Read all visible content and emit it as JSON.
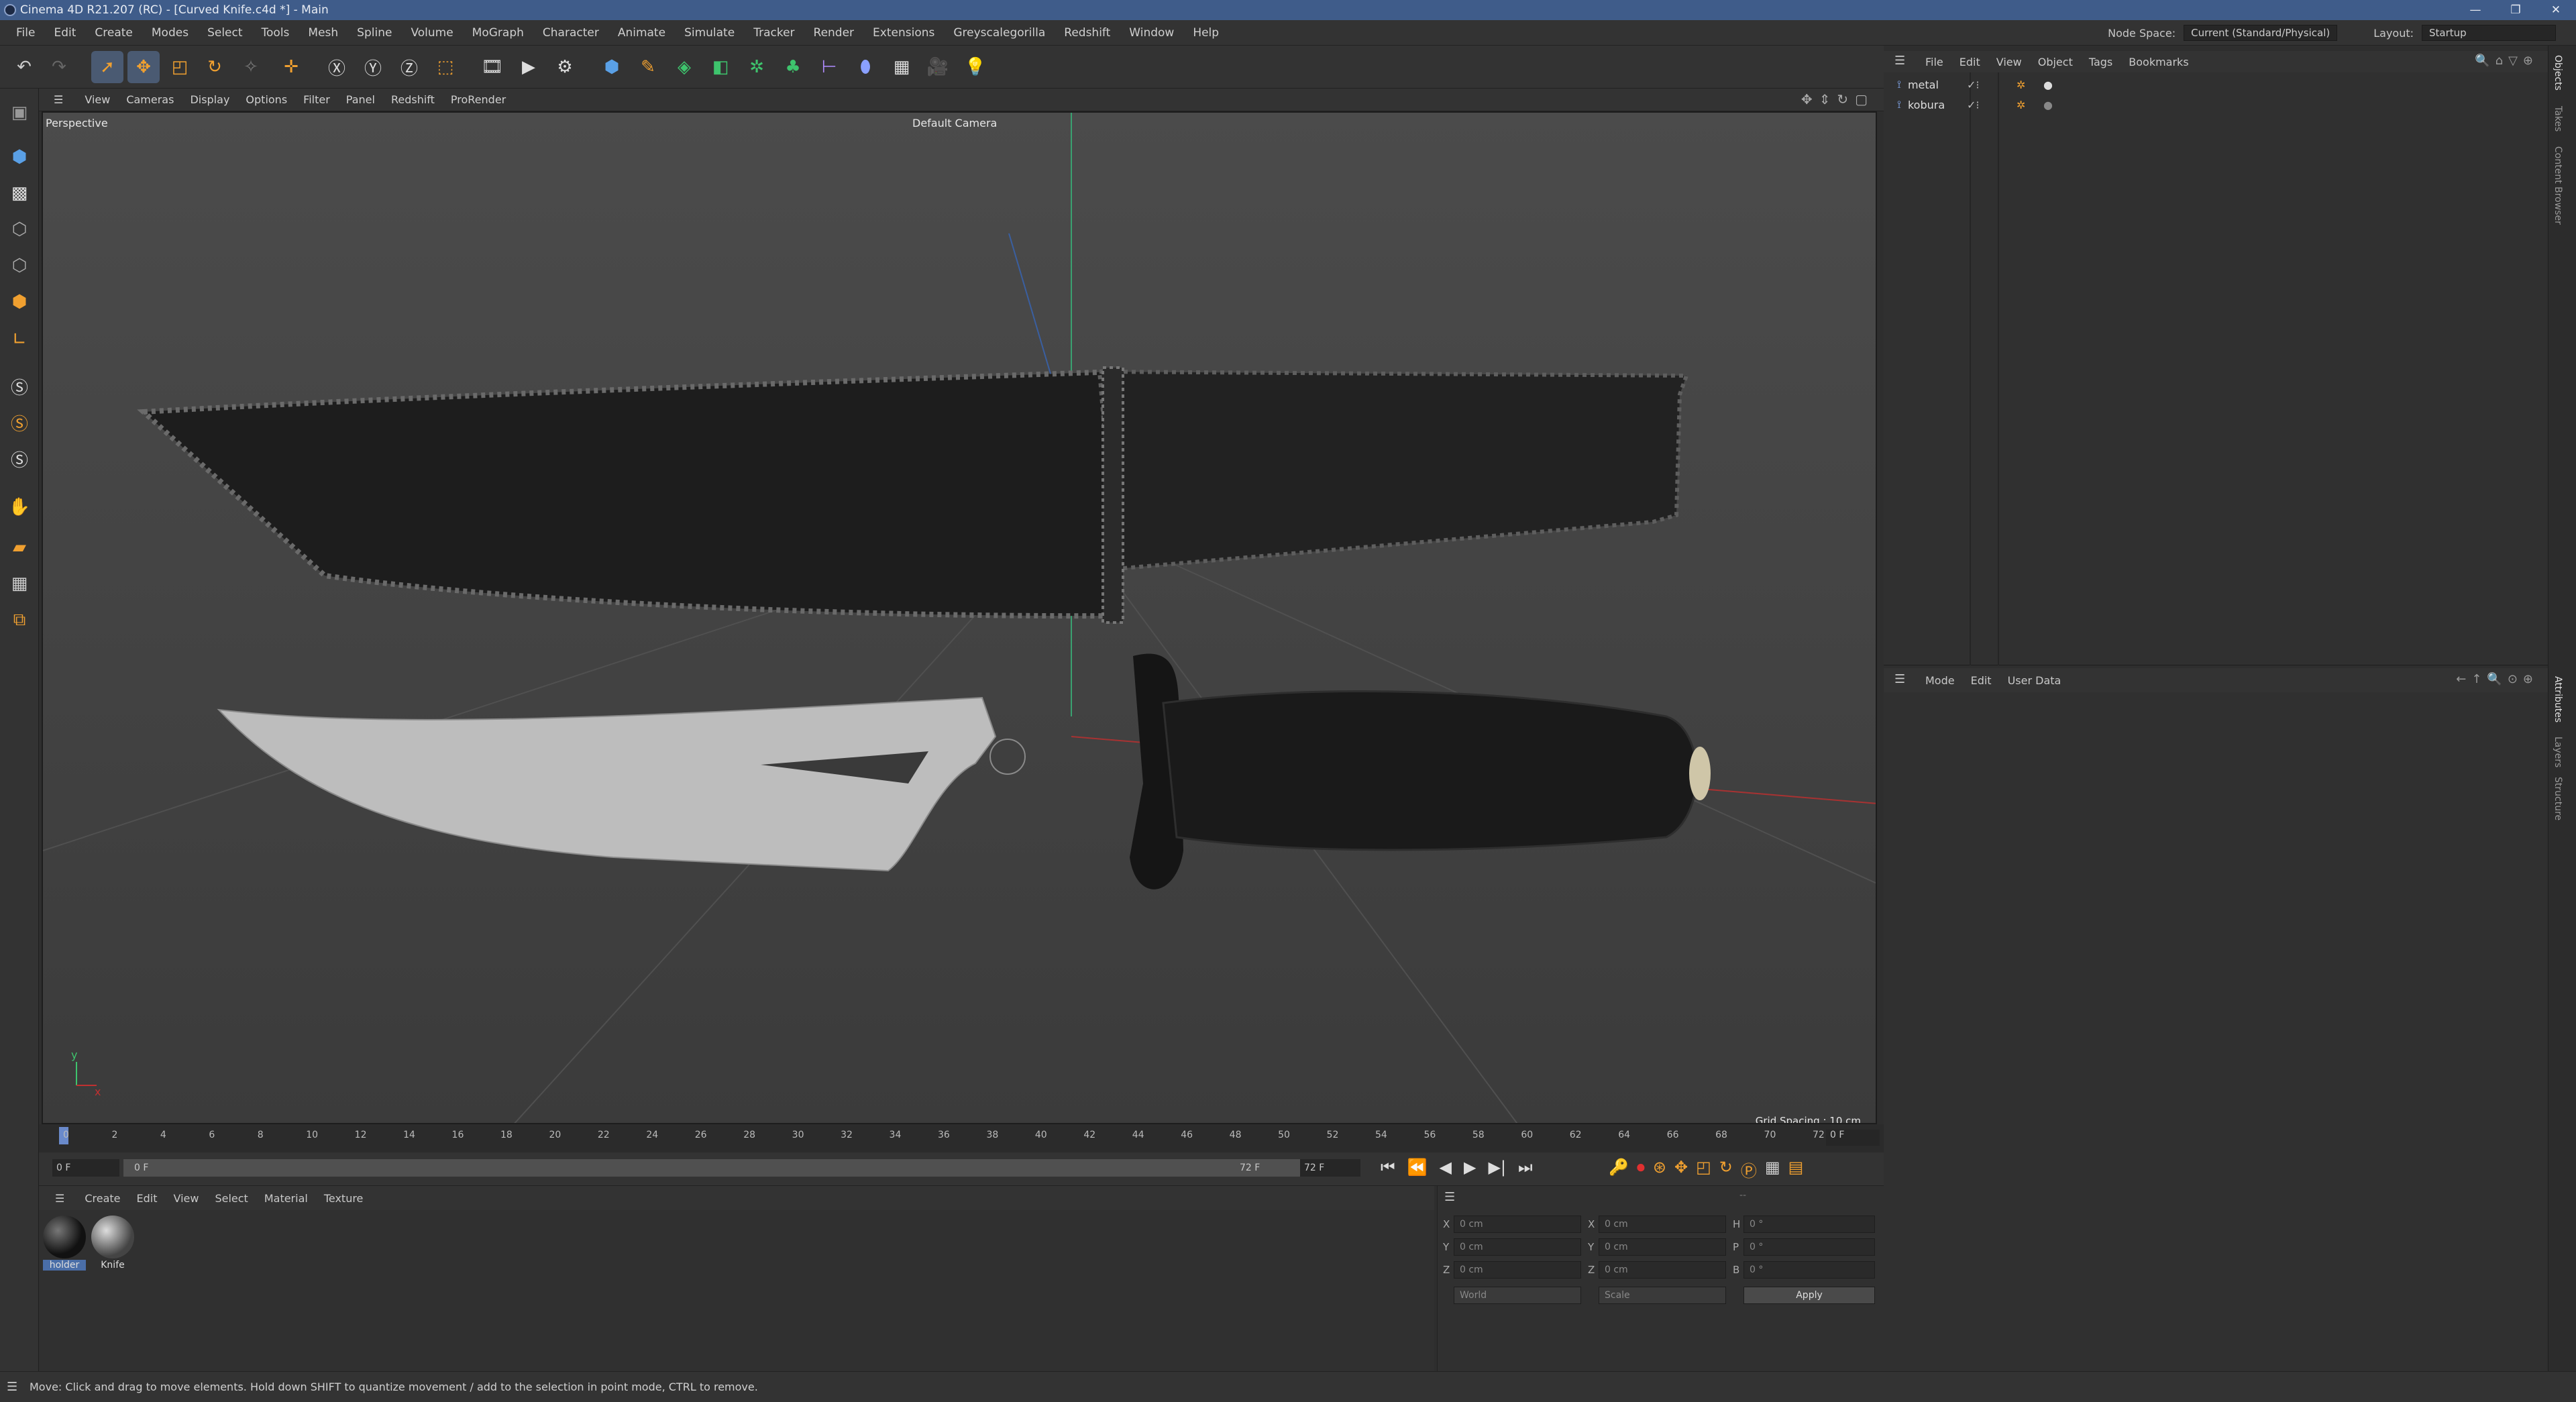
{
  "window": {
    "title": "Cinema 4D R21.207 (RC) - [Curved Knife.c4d *] - Main",
    "controls": [
      "—",
      "❐",
      "✕"
    ]
  },
  "menu": [
    "File",
    "Edit",
    "Create",
    "Modes",
    "Select",
    "Tools",
    "Mesh",
    "Spline",
    "Volume",
    "MoGraph",
    "Character",
    "Animate",
    "Simulate",
    "Tracker",
    "Render",
    "Extensions",
    "Greyscalegorilla",
    "Redshift",
    "Window",
    "Help"
  ],
  "node_space": {
    "label": "Node Space:",
    "value": "Current (Standard/Physical)"
  },
  "layout": {
    "label": "Layout:",
    "value": "Startup"
  },
  "viewport": {
    "menu": [
      "View",
      "Cameras",
      "Display",
      "Options",
      "Filter",
      "Panel",
      "Redshift",
      "ProRender"
    ],
    "projection": "Perspective",
    "camera": "Default Camera",
    "grid_spacing": "Grid Spacing : 10 cm"
  },
  "timeline": {
    "ticks": [
      "0",
      "2",
      "4",
      "6",
      "8",
      "10",
      "12",
      "14",
      "16",
      "18",
      "20",
      "22",
      "24",
      "26",
      "28",
      "30",
      "32",
      "34",
      "36",
      "38",
      "40",
      "42",
      "44",
      "46",
      "48",
      "50",
      "52",
      "54",
      "56",
      "58",
      "60",
      "62",
      "64",
      "66",
      "68",
      "70",
      "72"
    ],
    "current": "0 F",
    "start": "0 F",
    "start2": "0 F",
    "end": "72 F",
    "end2": "72 F"
  },
  "materials": {
    "menu": [
      "Create",
      "Edit",
      "View",
      "Select",
      "Material",
      "Texture"
    ],
    "items": [
      {
        "name": "holder"
      },
      {
        "name": "Knife"
      }
    ]
  },
  "coords": {
    "header": "--",
    "rows": [
      {
        "a": "X",
        "av": "0 cm",
        "b": "X",
        "bv": "0 cm",
        "c": "H",
        "cv": "0 °"
      },
      {
        "a": "Y",
        "av": "0 cm",
        "b": "Y",
        "bv": "0 cm",
        "c": "P",
        "cv": "0 °"
      },
      {
        "a": "Z",
        "av": "0 cm",
        "b": "Z",
        "bv": "0 cm",
        "c": "B",
        "cv": "0 °"
      }
    ],
    "world": "World",
    "scale": "Scale",
    "apply": "Apply"
  },
  "objects": {
    "menu": [
      "File",
      "Edit",
      "View",
      "Object",
      "Tags",
      "Bookmarks"
    ],
    "items": [
      {
        "name": "metal"
      },
      {
        "name": "kobura"
      }
    ]
  },
  "attributes": {
    "menu": [
      "Mode",
      "Edit",
      "User Data"
    ]
  },
  "right_tabs": [
    "Objects",
    "Takes",
    "Content Browser",
    "Attributes",
    "Layers",
    "Structure"
  ],
  "status": "Move: Click and drag to move elements. Hold down SHIFT to quantize movement / add to the selection in point mode, CTRL to remove.",
  "colors": {
    "title": "#3f5c8a",
    "accent": "#f0a030",
    "x_axis": "#c03030",
    "y_axis": "#30c070"
  }
}
